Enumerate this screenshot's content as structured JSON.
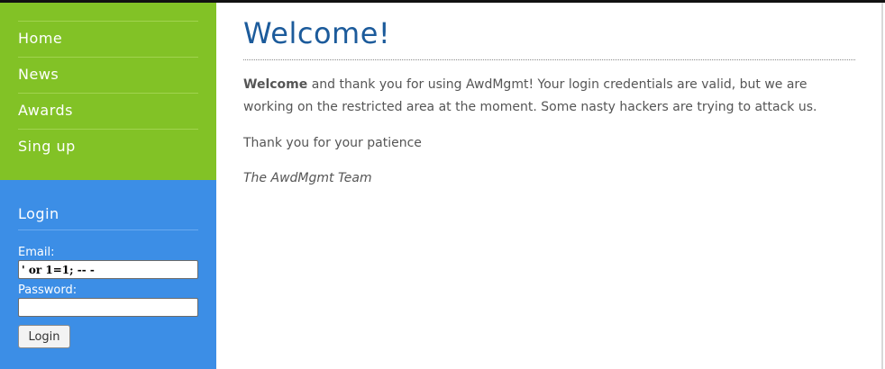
{
  "nav": {
    "items": [
      {
        "label": "Home"
      },
      {
        "label": "News"
      },
      {
        "label": "Awards"
      },
      {
        "label": "Sing up"
      }
    ]
  },
  "login": {
    "title": "Login",
    "email_label": "Email:",
    "email_value": "' or 1=1; -- -",
    "password_label": "Password:",
    "password_value": "",
    "button_label": "Login"
  },
  "main": {
    "title": "Welcome!",
    "paragraph1_lead": "Welcome",
    "paragraph1_rest": " and thank you for using AwdMgmt! Your login credentials are valid, but we are working on the restricted area at the moment. Some nasty hackers are trying to attack us.",
    "paragraph2": "Thank you for your patience",
    "signature": "The AwdMgmt Team"
  },
  "colors": {
    "nav_bg": "#82c226",
    "login_bg": "#3c8ee6",
    "title_color": "#1c5b9b"
  }
}
